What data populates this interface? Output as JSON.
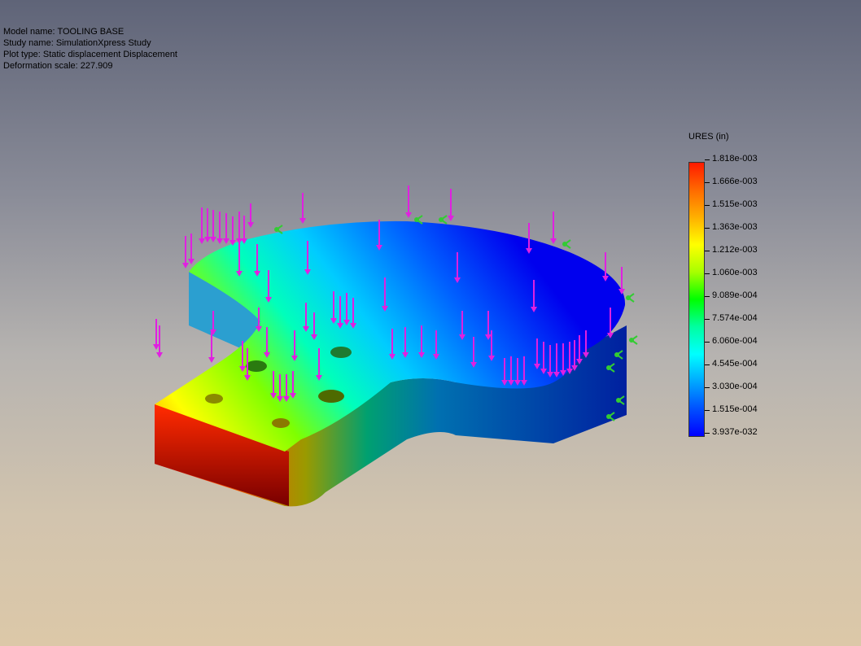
{
  "info": {
    "model_name": "Model name: TOOLING BASE",
    "study_name": "Study name: SimulationXpress Study",
    "plot_type": "Plot type: Static displacement Displacement",
    "deformation_scale": "Deformation scale: 227.909"
  },
  "legend": {
    "title": "URES (in)",
    "labels": [
      "1.818e-003",
      "1.666e-003",
      "1.515e-003",
      "1.363e-003",
      "1.212e-003",
      "1.060e-003",
      "9.089e-004",
      "7.574e-004",
      "6.060e-004",
      "4.545e-004",
      "3.030e-004",
      "1.515e-004",
      "3.937e-032"
    ]
  },
  "colors": {
    "load_arrow": "#e020e0",
    "fixture": "#33cc33"
  },
  "icons": {
    "load": "force-arrow-icon",
    "fixture": "fixture-icon"
  }
}
